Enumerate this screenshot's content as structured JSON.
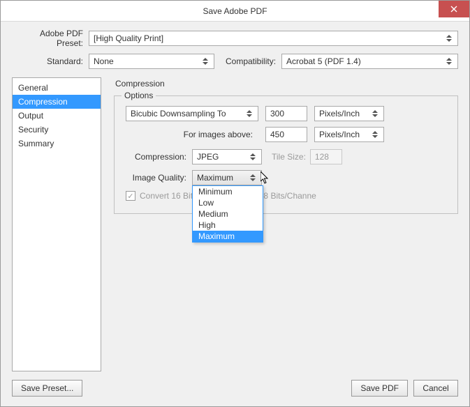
{
  "window": {
    "title": "Save Adobe PDF"
  },
  "preset": {
    "label": "Adobe PDF Preset:",
    "value": "[High Quality Print]"
  },
  "standard": {
    "label": "Standard:",
    "value": "None"
  },
  "compatibility": {
    "label": "Compatibility:",
    "value": "Acrobat 5 (PDF 1.4)"
  },
  "sidebar": {
    "items": [
      {
        "label": "General"
      },
      {
        "label": "Compression"
      },
      {
        "label": "Output"
      },
      {
        "label": "Security"
      },
      {
        "label": "Summary"
      }
    ],
    "active_index": 1
  },
  "panel": {
    "title": "Compression",
    "options_title": "Options",
    "downsample": {
      "method": "Bicubic Downsampling To",
      "dpi": "300",
      "unit": "Pixels/Inch",
      "above_label": "For images above:",
      "above_dpi": "450",
      "above_unit": "Pixels/Inch"
    },
    "compression": {
      "label": "Compression:",
      "value": "JPEG",
      "tile_label": "Tile Size:",
      "tile_value": "128"
    },
    "image_quality": {
      "label": "Image Quality:",
      "value": "Maximum",
      "options": [
        "Minimum",
        "Low",
        "Medium",
        "High",
        "Maximum"
      ],
      "highlight_index": 4
    },
    "convert": {
      "label": "Convert 16 Bit/Channel Image to 8 Bits/Channe",
      "checked": true
    }
  },
  "footer": {
    "save_preset": "Save Preset...",
    "save_pdf": "Save PDF",
    "cancel": "Cancel"
  }
}
